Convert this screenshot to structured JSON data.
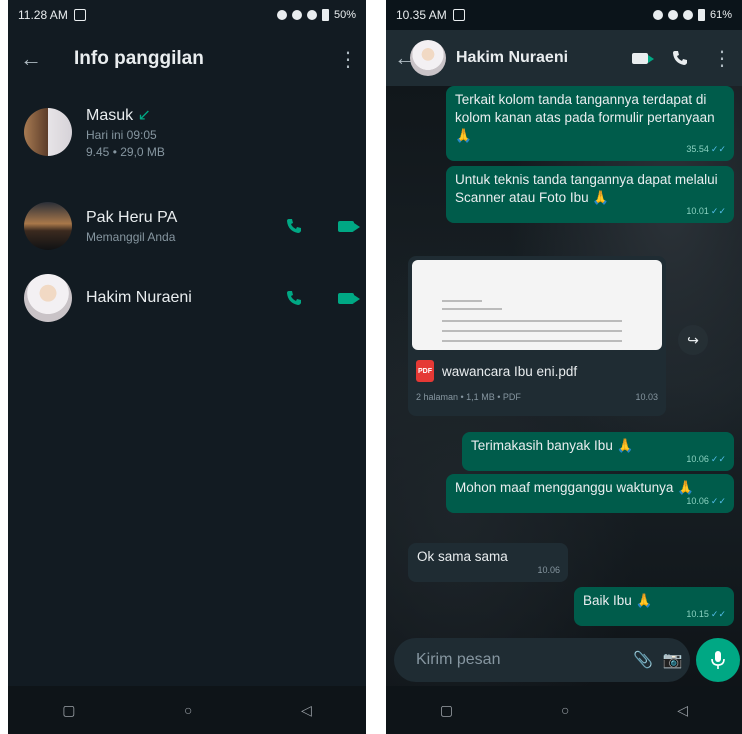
{
  "left": {
    "status": {
      "time": "11.28 AM",
      "battery": "50%"
    },
    "title": "Info panggilan",
    "call_entry": {
      "type": "Masuk",
      "date": "Hari ini 09:05",
      "detail": "9.45 • 29,0 MB"
    },
    "contacts": [
      {
        "name": "Pak Heru PA",
        "sub": "Memanggil Anda"
      },
      {
        "name": "Hakim Nuraeni",
        "sub": ""
      }
    ]
  },
  "right": {
    "status": {
      "time": "10.35 AM",
      "battery": "61%"
    },
    "contact_name": "Hakim Nuraeni",
    "messages": [
      {
        "text": "Terkait kolom tanda tangannya terdapat di kolom kanan atas pada formulir pertanyaan 🙏",
        "time": "35.54"
      },
      {
        "text": "Untuk teknis tanda tangannya dapat melalui Scanner atau Foto Ibu 🙏",
        "time": "10.01"
      },
      {
        "text": "Terimakasih banyak Ibu 🙏",
        "time": "10.06"
      },
      {
        "text": "Mohon maaf mengganggu waktunya 🙏",
        "time": "10.06"
      },
      {
        "text": "Ok sama sama",
        "time": "10.06"
      },
      {
        "text": "Baik Ibu 🙏",
        "time": "10.15"
      }
    ],
    "pdf": {
      "badge": "PDF",
      "name": "wawancara Ibu eni.pdf",
      "meta": "2 halaman • 1,1 MB • PDF",
      "time": "10.03"
    },
    "composer_placeholder": "Kirim pesan"
  }
}
